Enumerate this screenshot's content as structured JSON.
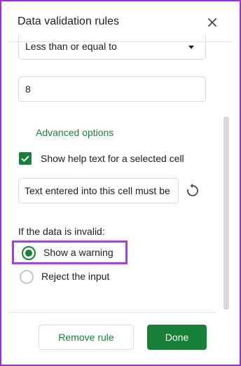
{
  "panel": {
    "title": "Data validation rules"
  },
  "criteria": {
    "condition": "Less than or equal to",
    "value": "8"
  },
  "advanced": {
    "label": "Advanced options",
    "help_text_checkbox": {
      "label": "Show help text for a selected cell",
      "checked": true
    },
    "help_text_value": "Text entered into this cell must be"
  },
  "invalid": {
    "heading": "If the data is invalid:",
    "options": [
      {
        "label": "Show a warning",
        "selected": true
      },
      {
        "label": "Reject the input",
        "selected": false
      }
    ]
  },
  "footer": {
    "remove_label": "Remove rule",
    "done_label": "Done"
  },
  "colors": {
    "accent_green": "#188038",
    "highlight_purple": "#a93ee0"
  },
  "icons": [
    "close-icon",
    "dropdown-caret-icon",
    "checkmark-icon",
    "reset-icon"
  ]
}
